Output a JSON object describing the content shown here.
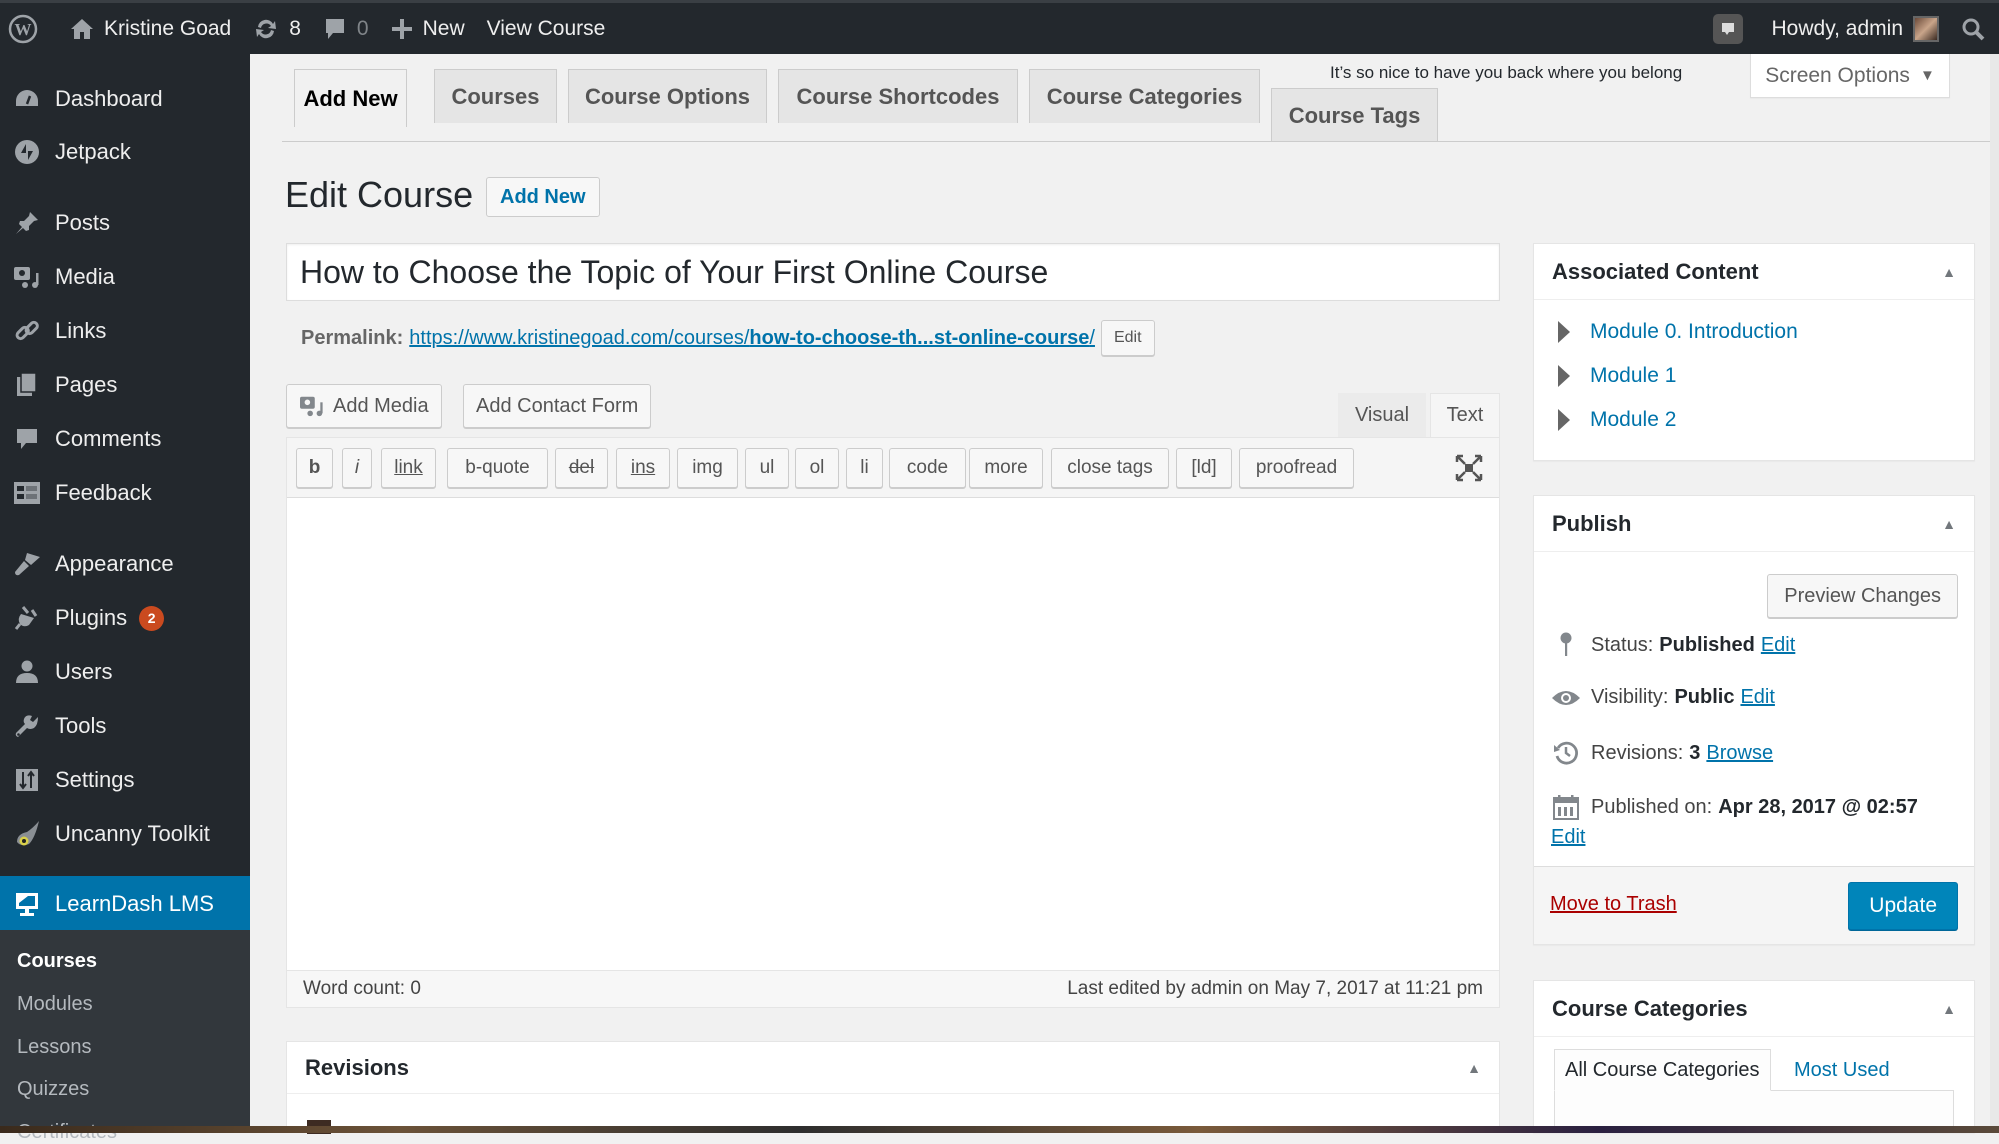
{
  "admin_bar": {
    "site_name": "Kristine Goad",
    "updates_count": "8",
    "comments_count": "0",
    "new_label": "New",
    "view_label": "View Course",
    "howdy": "Howdy, admin"
  },
  "sidebar": {
    "items": [
      {
        "label": "Dashboard",
        "icon": "dashboard-icon"
      },
      {
        "label": "Jetpack",
        "icon": "jetpack-icon"
      },
      {
        "label": "Posts",
        "icon": "pin-icon"
      },
      {
        "label": "Media",
        "icon": "media-icon"
      },
      {
        "label": "Links",
        "icon": "link-icon"
      },
      {
        "label": "Pages",
        "icon": "pages-icon"
      },
      {
        "label": "Comments",
        "icon": "comment-icon"
      },
      {
        "label": "Feedback",
        "icon": "feedback-icon"
      },
      {
        "label": "Appearance",
        "icon": "brush-icon"
      },
      {
        "label": "Plugins",
        "icon": "plugin-icon",
        "badge": "2"
      },
      {
        "label": "Users",
        "icon": "user-icon"
      },
      {
        "label": "Tools",
        "icon": "wrench-icon"
      },
      {
        "label": "Settings",
        "icon": "settings-icon"
      },
      {
        "label": "Uncanny Toolkit",
        "icon": "uncanny-eye-icon"
      },
      {
        "label": "LearnDash LMS",
        "icon": "monitor-icon",
        "current": true
      }
    ],
    "submenu": [
      "Courses",
      "Modules",
      "Lessons",
      "Quizzes",
      "Certificates"
    ]
  },
  "tabs": [
    "Add New",
    "Courses",
    "Course Options",
    "Course Shortcodes",
    "Course Categories",
    "Course Tags"
  ],
  "greeting": "It’s so nice to have you back where you belong",
  "screen_options": "Screen Options",
  "page": {
    "title": "Edit Course",
    "add_new": "Add New",
    "post_title": "How to Choose the Topic of Your First Online Course",
    "permalink_label": "Permalink:",
    "permalink_base": "https://www.kristinegoad.com/courses/",
    "permalink_slug": "how-to-choose-th...st-online-course",
    "permalink_trail": "/",
    "permalink_edit": "Edit"
  },
  "editor": {
    "add_media": "Add Media",
    "add_contact_form": "Add Contact Form",
    "tab_visual": "Visual",
    "tab_text": "Text",
    "quicktags": [
      "b",
      "i",
      "link",
      "b-quote",
      "del",
      "ins",
      "img",
      "ul",
      "ol",
      "li",
      "code",
      "more",
      "close tags",
      "[ld]",
      "proofread"
    ],
    "content": "",
    "word_count": "Word count: 0",
    "last_edited": "Last edited by admin on May 7, 2017 at 11:21 pm"
  },
  "revisions_box": {
    "title": "Revisions"
  },
  "associated_content": {
    "title": "Associated Content",
    "modules": [
      "Module 0. Introduction",
      "Module 1",
      "Module 2"
    ]
  },
  "publish": {
    "title": "Publish",
    "preview": "Preview Changes",
    "status_label": "Status:",
    "status_value": "Published",
    "status_edit": "Edit",
    "visibility_label": "Visibility:",
    "visibility_value": "Public",
    "visibility_edit": "Edit",
    "revisions_label": "Revisions:",
    "revisions_value": "3",
    "revisions_browse": "Browse",
    "published_label": "Published on:",
    "published_value": "Apr 28, 2017 @ 02:57",
    "published_edit": "Edit",
    "trash": "Move to Trash",
    "update": "Update"
  },
  "course_categories": {
    "title": "Course Categories",
    "tab_all": "All Course Categories",
    "tab_most_used": "Most Used"
  },
  "colors": {
    "accent": "#0073aa",
    "admin_bar": "#23282d",
    "badge": "#ca4a1f",
    "trash": "#aa0000",
    "update": "#0085ba"
  }
}
